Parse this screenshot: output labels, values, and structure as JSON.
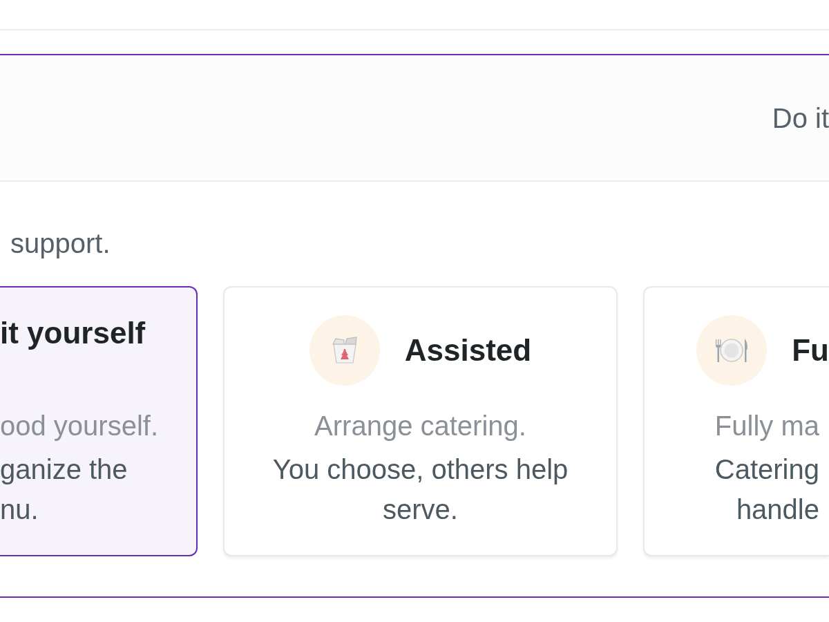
{
  "panel": {
    "header_title": "Do it",
    "intro": "support.",
    "options": [
      {
        "title": "it yourself",
        "subtitle": "ood yourself.",
        "description": [
          "ganize the",
          "nu."
        ],
        "selected": true
      },
      {
        "title": "Assisted",
        "subtitle": "Arrange catering.",
        "description": [
          "You choose, others help",
          "serve."
        ],
        "selected": false
      },
      {
        "title": "Fu",
        "subtitle": "Fully ma",
        "description": [
          "Catering",
          "handle"
        ],
        "selected": false
      }
    ]
  }
}
